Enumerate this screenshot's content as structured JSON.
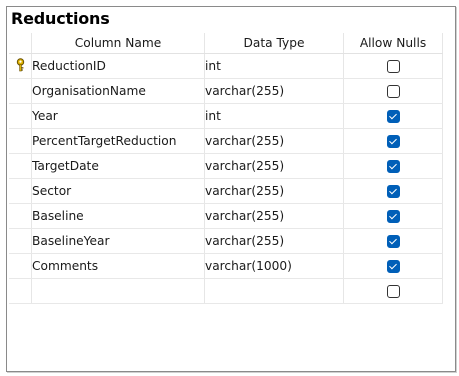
{
  "window": {
    "title": "Reductions"
  },
  "columns": {
    "name": "Column Name",
    "type": "Data Type",
    "nulls": "Allow Nulls"
  },
  "rows": [
    {
      "name": "ReductionID",
      "type": "int",
      "allow_nulls": false,
      "primary_key": true
    },
    {
      "name": "OrganisationName",
      "type": "varchar(255)",
      "allow_nulls": false
    },
    {
      "name": "Year",
      "type": "int",
      "allow_nulls": true
    },
    {
      "name": "PercentTargetReduction",
      "type": "varchar(255)",
      "allow_nulls": true
    },
    {
      "name": "TargetDate",
      "type": "varchar(255)",
      "allow_nulls": true
    },
    {
      "name": "Sector",
      "type": "varchar(255)",
      "allow_nulls": true
    },
    {
      "name": "Baseline",
      "type": "varchar(255)",
      "allow_nulls": true
    },
    {
      "name": "BaselineYear",
      "type": "varchar(255)",
      "allow_nulls": true
    },
    {
      "name": "Comments",
      "type": "varchar(1000)",
      "allow_nulls": true
    },
    {
      "name": "",
      "type": "",
      "allow_nulls": false
    }
  ],
  "icons": {
    "primary_key": "key-icon",
    "checkbox_checked": "checkbox-checked-icon",
    "checkbox_unchecked": "checkbox-unchecked-icon"
  },
  "colors": {
    "checkbox_accent": "#005fb8",
    "key_gold": "#e0b400"
  }
}
